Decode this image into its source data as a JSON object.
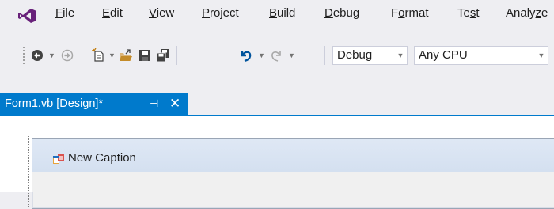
{
  "menu": {
    "items": [
      {
        "pre": "",
        "acc": "F",
        "post": "ile"
      },
      {
        "pre": "",
        "acc": "E",
        "post": "dit"
      },
      {
        "pre": "",
        "acc": "V",
        "post": "iew"
      },
      {
        "pre": "",
        "acc": "P",
        "post": "roject"
      },
      {
        "pre": "",
        "acc": "B",
        "post": "uild"
      },
      {
        "pre": "",
        "acc": "D",
        "post": "ebug"
      },
      {
        "pre": "F",
        "acc": "o",
        "post": "rmat"
      },
      {
        "pre": "Te",
        "acc": "s",
        "post": "t"
      },
      {
        "pre": "Analy",
        "acc": "z",
        "post": "e"
      }
    ]
  },
  "toolbar": {
    "configuration": "Debug",
    "platform": "Any CPU",
    "icons": [
      "back-icon",
      "forward-icon",
      "new-project-icon",
      "open-file-icon",
      "save-icon",
      "save-all-icon",
      "undo-icon",
      "redo-icon"
    ]
  },
  "document_tab": {
    "title": "Form1.vb [Design]*",
    "pin": "⊣",
    "close": "✕"
  },
  "form": {
    "caption": "New Caption"
  },
  "colors": {
    "accent": "#007acc",
    "background": "#eeeef2",
    "logo": "#68217a"
  }
}
